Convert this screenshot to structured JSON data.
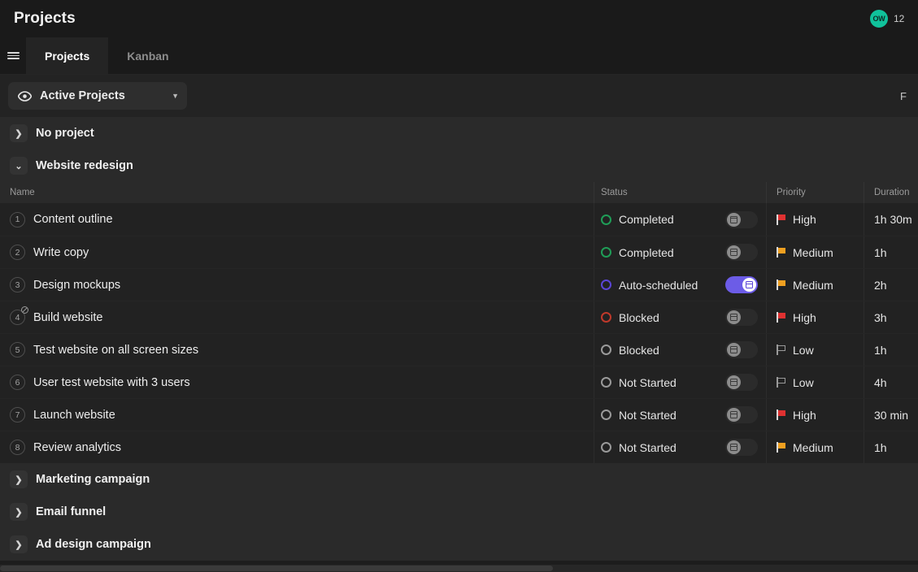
{
  "titlebar": {
    "title": "Projects",
    "avatar_initials": "OW",
    "clock": "12"
  },
  "tabs": {
    "menu_icon": "hamburger-icon",
    "items": [
      {
        "label": "Projects",
        "active": true
      },
      {
        "label": "Kanban",
        "active": false
      }
    ]
  },
  "filterbar": {
    "view_icon": "eye-icon",
    "view_label": "Active Projects",
    "caret_icon": "chevron-down-icon",
    "right_label": "F"
  },
  "columns": {
    "name": "Name",
    "status": "Status",
    "priority": "Priority",
    "duration": "Duration"
  },
  "groups": [
    {
      "name": "No project",
      "expanded": false,
      "icon": "chevron-right-icon"
    },
    {
      "name": "Website redesign",
      "expanded": true,
      "icon": "chevron-down-icon"
    },
    {
      "name": "Marketing campaign",
      "expanded": false,
      "icon": "chevron-right-icon"
    },
    {
      "name": "Email funnel",
      "expanded": false,
      "icon": "chevron-right-icon"
    },
    {
      "name": "Ad design campaign",
      "expanded": false,
      "icon": "chevron-right-icon"
    }
  ],
  "tasks": [
    {
      "num": "1",
      "name": "Content outline",
      "blocked_badge": false,
      "status": "Completed",
      "status_color": "green",
      "auto_schedule": false,
      "priority": "High",
      "priority_level": "high",
      "duration": "1h 30m"
    },
    {
      "num": "2",
      "name": "Write copy",
      "blocked_badge": false,
      "status": "Completed",
      "status_color": "green",
      "auto_schedule": false,
      "priority": "Medium",
      "priority_level": "medium",
      "duration": "1h"
    },
    {
      "num": "3",
      "name": "Design mockups",
      "blocked_badge": false,
      "status": "Auto-scheduled",
      "status_color": "purple",
      "auto_schedule": true,
      "priority": "Medium",
      "priority_level": "medium",
      "duration": "2h"
    },
    {
      "num": "4",
      "name": "Build website",
      "blocked_badge": true,
      "status": "Blocked",
      "status_color": "red",
      "auto_schedule": false,
      "priority": "High",
      "priority_level": "high",
      "duration": "3h"
    },
    {
      "num": "5",
      "name": "Test website on all screen sizes",
      "blocked_badge": false,
      "status": "Blocked",
      "status_color": "gray",
      "auto_schedule": false,
      "priority": "Low",
      "priority_level": "low",
      "duration": "1h"
    },
    {
      "num": "6",
      "name": "User test website with 3 users",
      "blocked_badge": false,
      "status": "Not Started",
      "status_color": "gray",
      "auto_schedule": false,
      "priority": "Low",
      "priority_level": "low",
      "duration": "4h"
    },
    {
      "num": "7",
      "name": "Launch website",
      "blocked_badge": false,
      "status": "Not Started",
      "status_color": "gray",
      "auto_schedule": false,
      "priority": "High",
      "priority_level": "high",
      "duration": "30 min"
    },
    {
      "num": "8",
      "name": "Review analytics",
      "blocked_badge": false,
      "status": "Not Started",
      "status_color": "gray",
      "auto_schedule": false,
      "priority": "Medium",
      "priority_level": "medium",
      "duration": "1h"
    }
  ],
  "colors": {
    "accent_purple": "#6c5ce7",
    "status_green": "#1f9d57",
    "status_red": "#c0392b",
    "priority_high": "#e03131",
    "priority_medium": "#f0a020",
    "avatar_green": "#10c29b"
  }
}
